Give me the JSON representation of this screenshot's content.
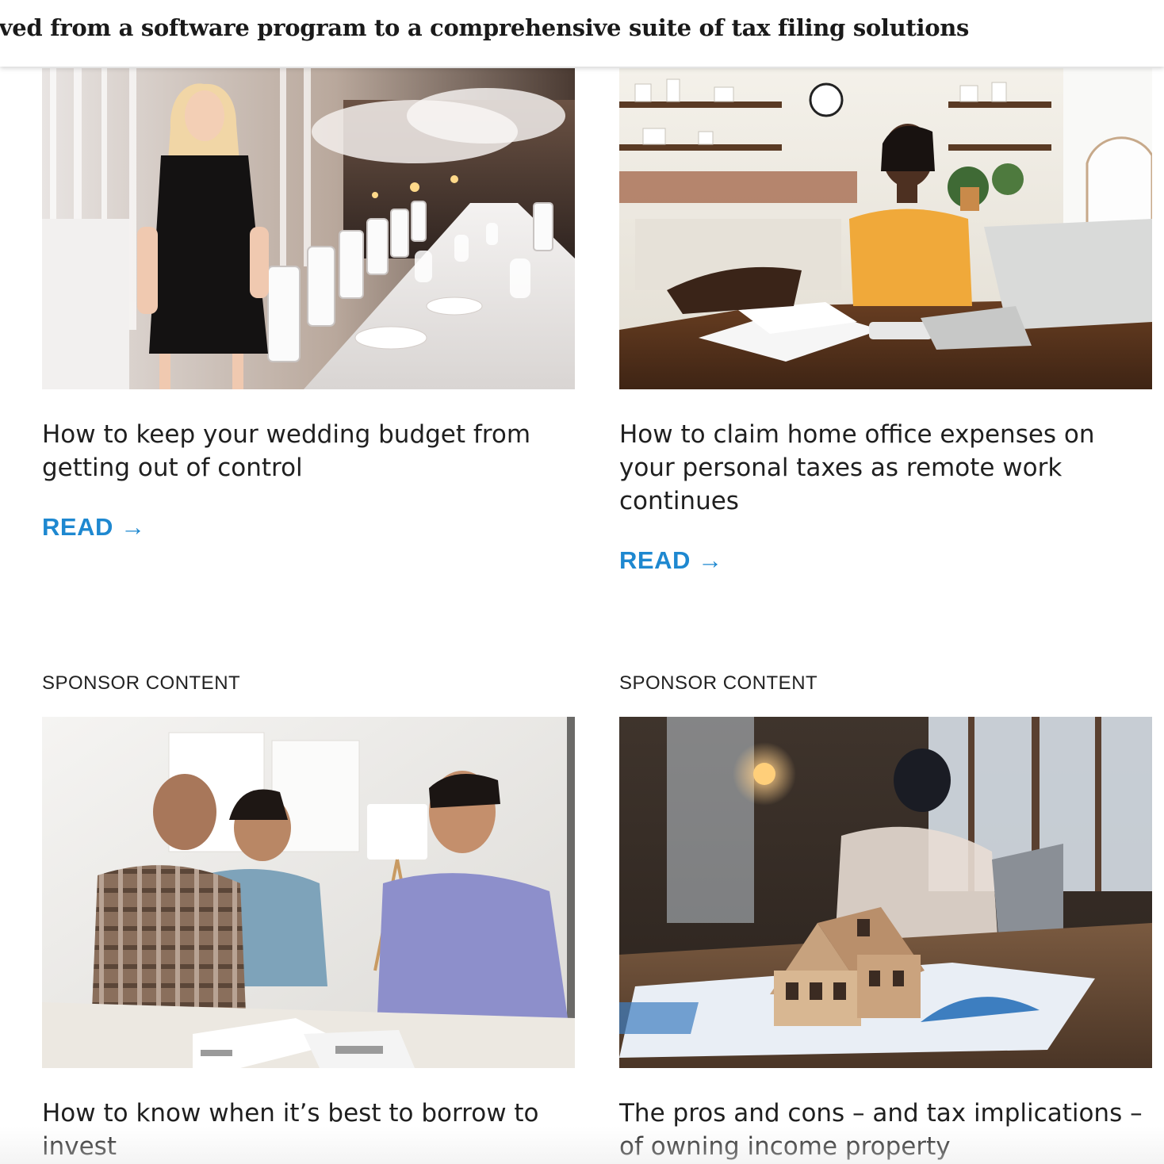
{
  "header": {
    "title": "lved from a software program to a comprehensive suite of tax filing solutions"
  },
  "cards": [
    {
      "title": "How to keep your wedding budget from getting out of control",
      "read_label": "READ →",
      "image": "wedding-venue-photo"
    },
    {
      "title": "How to claim home office expenses on your personal taxes as remote work continues",
      "read_label": "READ →",
      "image": "home-office-photo"
    },
    {
      "sponsor_label": "SPONSOR CONTENT",
      "title": "How to know when it’s best to borrow to invest",
      "image": "advisor-meeting-photo"
    },
    {
      "sponsor_label": "SPONSOR CONTENT",
      "title": "The pros and cons – and tax implications – of owning income property",
      "image": "house-model-photo"
    }
  ],
  "colors": {
    "link": "#1e88d0",
    "text": "#1f1f1f"
  }
}
